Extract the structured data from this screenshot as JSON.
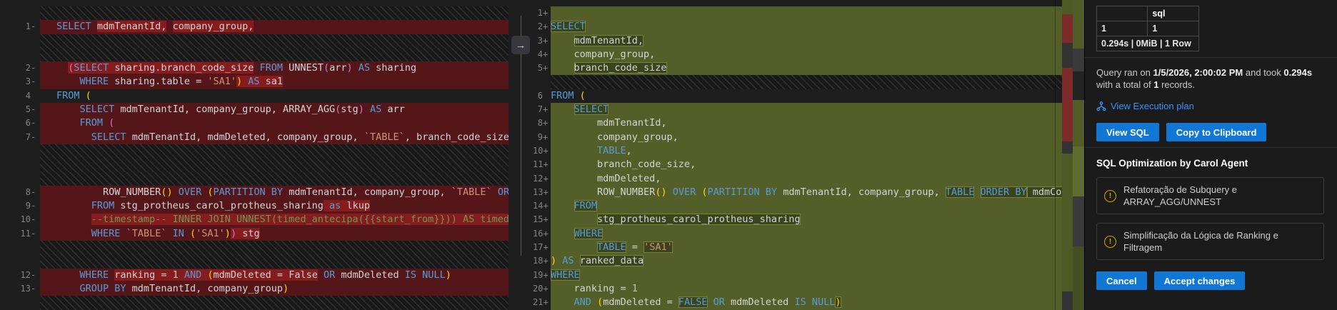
{
  "colors": {
    "accent_blue": "#1177d4",
    "link_blue": "#3794ff",
    "warning_yellow": "#cca700",
    "added_line_bg": "#545e29",
    "removed_line_bg": "#55161a"
  },
  "diff": {
    "arrow_glyph": "→",
    "left": {
      "rows": [
        {
          "type": "sp"
        },
        {
          "type": "code",
          "num": "1",
          "sign": "-",
          "bg": "del",
          "segs": [
            [
              "SELECT ",
              "k"
            ],
            [
              "mdmTenantId,",
              "i",
              1
            ],
            [
              " ",
              "i"
            ],
            [
              "company_group,",
              "i",
              1
            ]
          ]
        },
        {
          "type": "sp"
        },
        {
          "type": "sp"
        },
        {
          "type": "code",
          "num": "2",
          "sign": "-",
          "bg": "del",
          "segs": [
            [
              "  ",
              "i"
            ],
            [
              "(",
              "p2",
              1
            ],
            [
              "SELECT",
              "k",
              1
            ],
            [
              " sharing.branch_code_size",
              "i",
              1
            ],
            [
              " ",
              "i"
            ],
            [
              "FROM",
              "k"
            ],
            [
              " UNNEST",
              "i"
            ],
            [
              "(",
              "p2"
            ],
            [
              "arr",
              "i"
            ],
            [
              ")",
              "p2"
            ],
            [
              " ",
              "i"
            ],
            [
              "AS",
              "k"
            ],
            [
              " sharing",
              "i"
            ]
          ]
        },
        {
          "type": "code",
          "num": "3",
          "sign": "-",
          "bg": "del",
          "segs": [
            [
              "    ",
              "i"
            ],
            [
              "WHERE",
              "k"
            ],
            [
              " sharing.table = ",
              "i"
            ],
            [
              "'SA1'",
              "s"
            ],
            [
              ")",
              "p1",
              1
            ],
            [
              " ",
              "i",
              1
            ],
            [
              "AS",
              "k",
              1
            ],
            [
              " sa1",
              "i",
              1
            ]
          ]
        },
        {
          "type": "code",
          "num": "4",
          "sign": "",
          "bg": "ctx",
          "segs": [
            [
              "FROM",
              "k"
            ],
            [
              " ",
              "i"
            ],
            [
              "(",
              "p1"
            ]
          ]
        },
        {
          "type": "code",
          "num": "5",
          "sign": "-",
          "bg": "del",
          "segs": [
            [
              "    ",
              "i"
            ],
            [
              "SELECT",
              "k"
            ],
            [
              " mdmTenantId, company_group, ARRAY_AGG",
              "i"
            ],
            [
              "(",
              "p2"
            ],
            [
              "stg",
              "i"
            ],
            [
              ")",
              "p2"
            ],
            [
              " ",
              "i"
            ],
            [
              "AS",
              "k"
            ],
            [
              " arr",
              "i"
            ]
          ]
        },
        {
          "type": "code",
          "num": "6",
          "sign": "-",
          "bg": "del",
          "segs": [
            [
              "    ",
              "i"
            ],
            [
              "FROM",
              "k"
            ],
            [
              " ",
              "i"
            ],
            [
              "(",
              "p2"
            ]
          ]
        },
        {
          "type": "code",
          "num": "7",
          "sign": "-",
          "bg": "del",
          "segs": [
            [
              "      ",
              "i"
            ],
            [
              "SELECT",
              "k"
            ],
            [
              " mdmTenantId, mdmDeleted, company_group, ",
              "i"
            ],
            [
              "`TABLE`",
              "s"
            ],
            [
              ", branch_code_size,",
              "i"
            ]
          ]
        },
        {
          "type": "sp"
        },
        {
          "type": "sp"
        },
        {
          "type": "sp"
        },
        {
          "type": "code",
          "num": "8",
          "sign": "-",
          "bg": "del",
          "segs": [
            [
              "        ",
              "i"
            ],
            [
              "ROW_NUMBER",
              "i"
            ],
            [
              "()",
              "p1"
            ],
            [
              " ",
              "i"
            ],
            [
              "OVER",
              "k"
            ],
            [
              " ",
              "i"
            ],
            [
              "(",
              "p1"
            ],
            [
              "PARTITION BY",
              "k"
            ],
            [
              " mdmTenantId, company_group, ",
              "i"
            ],
            [
              "`TABLE`",
              "s"
            ],
            [
              " ",
              "i"
            ],
            [
              "ORDE",
              "k"
            ]
          ]
        },
        {
          "type": "code",
          "num": "9",
          "sign": "-",
          "bg": "del",
          "segs": [
            [
              "      ",
              "i"
            ],
            [
              "FROM",
              "k"
            ],
            [
              " stg_protheus_carol_protheus_sharing",
              "i"
            ],
            [
              " ",
              "i",
              1
            ],
            [
              "as",
              "k",
              1
            ],
            [
              " lkup",
              "i",
              1
            ]
          ]
        },
        {
          "type": "code",
          "num": "10",
          "sign": "-",
          "bg": "del",
          "segs": [
            [
              "      ",
              "c"
            ],
            [
              "--timestamp-- INNER JOIN UNNEST(timed_antecipa({{start_from}})) AS timed O",
              "c",
              1
            ]
          ]
        },
        {
          "type": "code",
          "num": "11",
          "sign": "-",
          "bg": "del",
          "segs": [
            [
              "      ",
              "i"
            ],
            [
              "WHERE",
              "k"
            ],
            [
              " ",
              "i"
            ],
            [
              "`TABLE`",
              "s"
            ],
            [
              " ",
              "i"
            ],
            [
              "IN",
              "k"
            ],
            [
              " ",
              "i"
            ],
            [
              "(",
              "p1"
            ],
            [
              "'SA1'",
              "s"
            ],
            [
              ")",
              "p1"
            ],
            [
              ")",
              "p2",
              1
            ],
            [
              " stg",
              "i",
              1
            ]
          ]
        },
        {
          "type": "sp"
        },
        {
          "type": "sp"
        },
        {
          "type": "code",
          "num": "12",
          "sign": "-",
          "bg": "del",
          "segs": [
            [
              "    ",
              "i"
            ],
            [
              "WHERE",
              "k"
            ],
            [
              " ",
              "i"
            ],
            [
              "ranking = ",
              "i",
              1
            ],
            [
              "1",
              "n",
              1
            ],
            [
              " ",
              "i",
              1
            ],
            [
              "AND",
              "k",
              1
            ],
            [
              " ",
              "i",
              1
            ],
            [
              "(",
              "p1",
              1
            ],
            [
              "mdmDeleted = False",
              "i",
              1
            ],
            [
              " ",
              "i"
            ],
            [
              "OR",
              "k"
            ],
            [
              " mdmDeleted ",
              "i"
            ],
            [
              "IS NULL",
              "k"
            ],
            [
              ")",
              "p1"
            ]
          ]
        },
        {
          "type": "code",
          "num": "13",
          "sign": "-",
          "bg": "del",
          "segs": [
            [
              "    ",
              "i"
            ],
            [
              "GROUP BY",
              "k"
            ],
            [
              " mdmTenantId, company_group",
              "i"
            ],
            [
              ")",
              "p1"
            ]
          ]
        },
        {
          "type": "sp"
        }
      ]
    },
    "right": {
      "rows": [
        {
          "type": "code",
          "num": "1",
          "sign": "+",
          "bg": "add",
          "segs": []
        },
        {
          "type": "code",
          "num": "2",
          "sign": "+",
          "bg": "add",
          "segs": [
            [
              "SELECT",
              "k",
              1
            ]
          ]
        },
        {
          "type": "code",
          "num": "3",
          "sign": "+",
          "bg": "add",
          "segs": [
            [
              "    ",
              "i"
            ],
            [
              "mdmTenantId,",
              "i",
              1
            ]
          ]
        },
        {
          "type": "code",
          "num": "4",
          "sign": "+",
          "bg": "add",
          "segs": [
            [
              "    company_group,",
              "i"
            ]
          ]
        },
        {
          "type": "code",
          "num": "5",
          "sign": "+",
          "bg": "add",
          "segs": [
            [
              "    ",
              "i"
            ],
            [
              "branch_code_size",
              "i",
              1
            ]
          ]
        },
        {
          "type": "sp"
        },
        {
          "type": "code",
          "num": "6",
          "sign": "",
          "bg": "ctx",
          "segs": [
            [
              "FROM",
              "k"
            ],
            [
              " ",
              "i"
            ],
            [
              "(",
              "p1"
            ]
          ]
        },
        {
          "type": "code",
          "num": "7",
          "sign": "+",
          "bg": "add",
          "segs": [
            [
              "    ",
              "i"
            ],
            [
              "SELECT",
              "k",
              1
            ]
          ]
        },
        {
          "type": "code",
          "num": "8",
          "sign": "+",
          "bg": "add",
          "segs": [
            [
              "        mdmTenantId,",
              "i"
            ]
          ]
        },
        {
          "type": "code",
          "num": "9",
          "sign": "+",
          "bg": "add",
          "segs": [
            [
              "        company_group,",
              "i"
            ]
          ]
        },
        {
          "type": "code",
          "num": "10",
          "sign": "+",
          "bg": "add",
          "segs": [
            [
              "        ",
              "i"
            ],
            [
              "TABLE",
              "k"
            ],
            [
              ",",
              "i"
            ]
          ]
        },
        {
          "type": "code",
          "num": "11",
          "sign": "+",
          "bg": "add",
          "segs": [
            [
              "        branch_code_size,",
              "i"
            ]
          ]
        },
        {
          "type": "code",
          "num": "12",
          "sign": "+",
          "bg": "add",
          "segs": [
            [
              "        mdmDeleted,",
              "i"
            ]
          ]
        },
        {
          "type": "code",
          "num": "13",
          "sign": "+",
          "bg": "add",
          "segs": [
            [
              "        ",
              "i"
            ],
            [
              "ROW_NUMBER",
              "i"
            ],
            [
              "()",
              "p1"
            ],
            [
              " ",
              "i"
            ],
            [
              "OVER",
              "k"
            ],
            [
              " ",
              "i"
            ],
            [
              "(",
              "p1"
            ],
            [
              "PARTITION BY",
              "k"
            ],
            [
              " mdmTenantId, company_group, ",
              "i"
            ],
            [
              "TABLE",
              "k",
              1
            ],
            [
              " ",
              "i"
            ],
            [
              "ORDER BY",
              "k",
              1
            ],
            [
              " mdmCou",
              "i",
              1
            ]
          ]
        },
        {
          "type": "code",
          "num": "14",
          "sign": "+",
          "bg": "add",
          "segs": [
            [
              "    ",
              "i"
            ],
            [
              "FROM",
              "k",
              1
            ]
          ]
        },
        {
          "type": "code",
          "num": "15",
          "sign": "+",
          "bg": "add",
          "segs": [
            [
              "        ",
              "i"
            ],
            [
              "stg_protheus_carol_protheus_sharing",
              "i",
              1
            ]
          ]
        },
        {
          "type": "code",
          "num": "16",
          "sign": "+",
          "bg": "add",
          "segs": [
            [
              "    ",
              "i"
            ],
            [
              "WHERE",
              "k",
              1
            ]
          ]
        },
        {
          "type": "code",
          "num": "17",
          "sign": "+",
          "bg": "add",
          "segs": [
            [
              "        ",
              "i"
            ],
            [
              "TABLE",
              "k",
              1
            ],
            [
              " = ",
              "i"
            ],
            [
              "'SA1'",
              "s",
              1
            ]
          ]
        },
        {
          "type": "code",
          "num": "18",
          "sign": "+",
          "bg": "add",
          "segs": [
            [
              ")",
              "p1"
            ],
            [
              " ",
              "i"
            ],
            [
              "AS",
              "k"
            ],
            [
              " ",
              "i"
            ],
            [
              "ranked_data",
              "i",
              1
            ]
          ]
        },
        {
          "type": "code",
          "num": "19",
          "sign": "+",
          "bg": "add",
          "segs": [
            [
              "WHERE",
              "k",
              1
            ]
          ]
        },
        {
          "type": "code",
          "num": "20",
          "sign": "+",
          "bg": "add",
          "segs": [
            [
              "    ",
              "i"
            ],
            [
              "ranking = ",
              "i"
            ],
            [
              "1",
              "n"
            ]
          ]
        },
        {
          "type": "code",
          "num": "21",
          "sign": "+",
          "bg": "add",
          "segs": [
            [
              "    ",
              "i"
            ],
            [
              "AND",
              "k"
            ],
            [
              " ",
              "i"
            ],
            [
              "(",
              "p1"
            ],
            [
              "mdmDeleted = ",
              "i"
            ],
            [
              "FALSE",
              "k",
              1
            ],
            [
              " ",
              "i"
            ],
            [
              "OR",
              "k"
            ],
            [
              " mdmDeleted ",
              "i"
            ],
            [
              "IS NULL",
              "k"
            ],
            [
              ")",
              "p1",
              1
            ]
          ]
        }
      ],
      "ruler_a": [
        [
          0,
          20,
          "#4f5926"
        ],
        [
          20,
          60,
          "#7c2a2a"
        ],
        [
          60,
          95,
          "#333333"
        ],
        [
          95,
          198,
          "#7c2a2a"
        ],
        [
          198,
          215,
          "#333333"
        ],
        [
          215,
          408,
          "#4f5926"
        ],
        [
          408,
          434,
          "#333333"
        ]
      ],
      "ruler_b": [
        [
          0,
          68,
          "#515c29"
        ],
        [
          68,
          100,
          "#3a3a3a"
        ],
        [
          100,
          140,
          "#232323"
        ],
        [
          140,
          205,
          "#515c29"
        ],
        [
          205,
          275,
          "#5f6b30"
        ],
        [
          275,
          345,
          "#3a3a3a"
        ],
        [
          345,
          434,
          "#464f23"
        ]
      ]
    }
  },
  "sidebar": {
    "results_table": {
      "corner": "",
      "col_header": "sql",
      "row_index": "1",
      "row_value": "1",
      "footer": "0.294s | 0MiB | 1 Row"
    },
    "query_summary_parts": [
      [
        "Query ran on ",
        0
      ],
      [
        "1/5/2026, 2:00:02 PM",
        1
      ],
      [
        " and took ",
        0
      ],
      [
        "0.294s",
        1
      ],
      [
        " with a total of ",
        0
      ],
      [
        "1",
        1
      ],
      [
        " records.",
        0
      ]
    ],
    "execution_plan_label": "View Execution plan",
    "view_sql_label": "View SQL",
    "copy_label": "Copy to Clipboard",
    "optimization": {
      "title": "SQL Optimization by Carol Agent",
      "items": [
        {
          "text": "Refatoração de Subquery e ARRAY_AGG/UNNEST"
        },
        {
          "text": "Simplificação da Lógica de Ranking e Filtragem"
        }
      ]
    },
    "cancel_label": "Cancel",
    "accept_label": "Accept changes"
  }
}
